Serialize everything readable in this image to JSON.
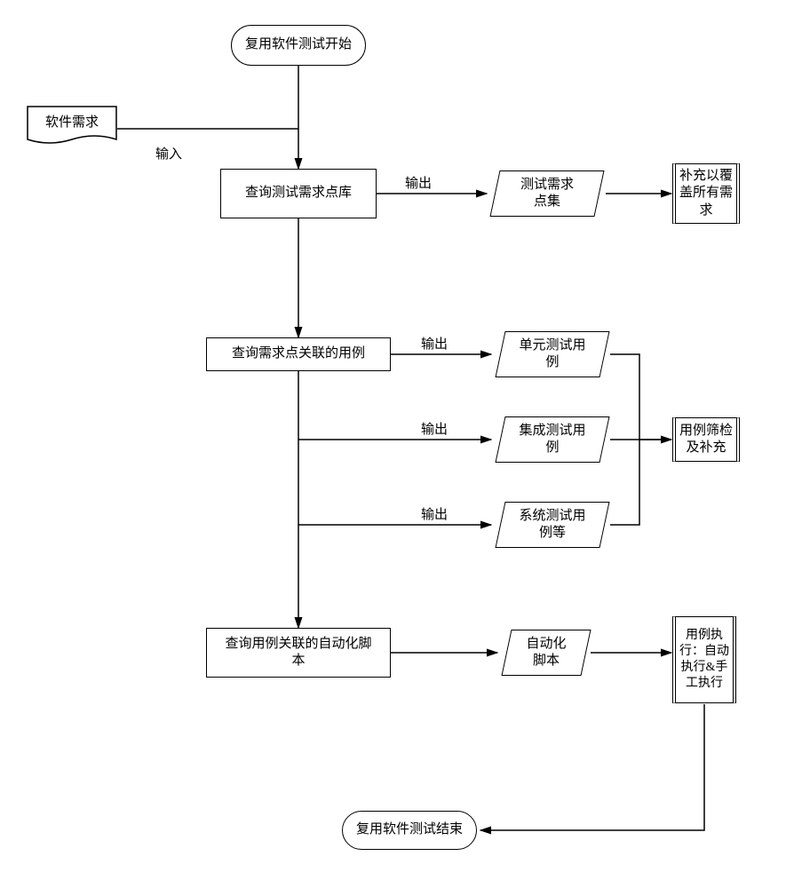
{
  "terminator_start": "复用软件测试开始",
  "terminator_end": "复用软件测试结束",
  "doc_sw_req": "软件需求",
  "label_input": "输入",
  "label_output1": "输出",
  "label_output2": "输出",
  "label_output3": "输出",
  "label_output4": "输出",
  "proc_query_reqlib": "查询测试需求点库",
  "proc_query_cases": "查询需求点关联的用例",
  "proc_query_scripts": "查询用例关联的自动化脚\n本",
  "data_reqset": "测试需求\n点集",
  "data_unitcase": "单元测试用\n例",
  "data_intcase": "集成测试用\n例",
  "data_syscase": "系统测试用\n例等",
  "data_autoscript": "自动化\n脚本",
  "predef_supplement_req": "补充以覆\n盖所有需\n求",
  "predef_filter_cases": "用例筛检\n及补充",
  "predef_exec": "用例执\n行：自动\n执行&手\n工执行"
}
